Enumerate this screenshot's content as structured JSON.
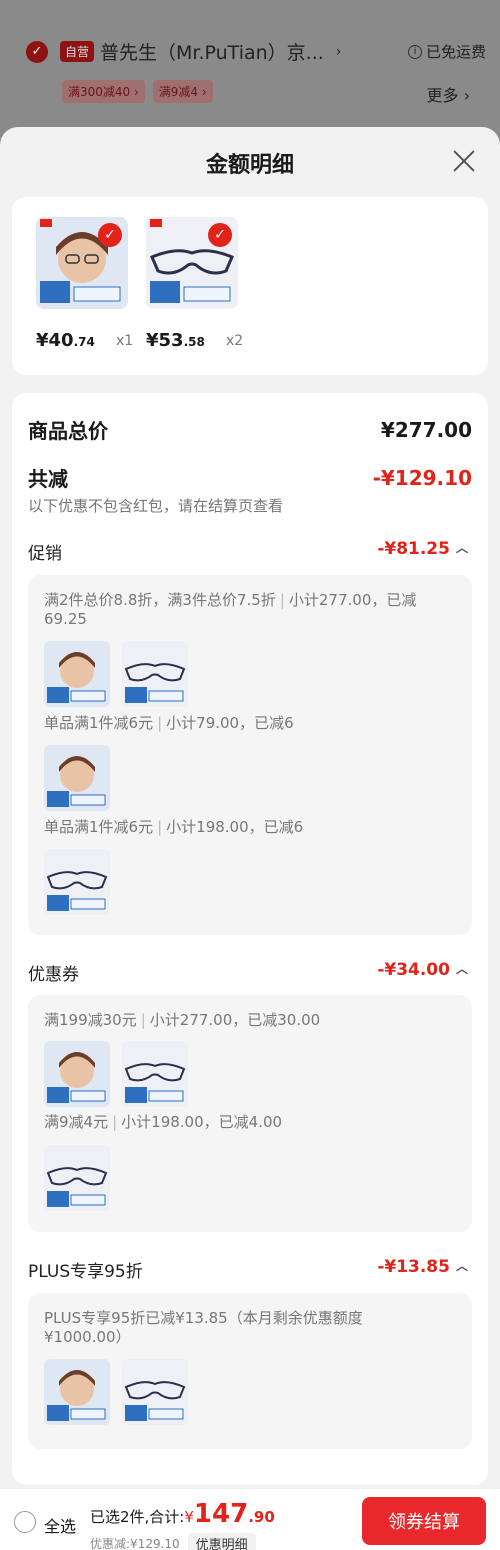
{
  "background": {
    "self_badge": "自营",
    "store_name": "普先生（Mr.PuTian）京...",
    "arrow": "›",
    "shipping": "已免运费",
    "info": "i",
    "tags": [
      "满300减40 ›",
      "满9减4 ›"
    ],
    "more": "更多 ›"
  },
  "sheet": {
    "title": "金额明细"
  },
  "products": [
    {
      "price_main": "¥40",
      "price_dec": ".74",
      "qty": "x1"
    },
    {
      "price_main": "¥53",
      "price_dec": ".58",
      "qty": "x2"
    }
  ],
  "summary": {
    "total_label": "商品总价",
    "total_value": "¥277.00",
    "discount_label": "共减",
    "discount_value": "-¥129.10",
    "discount_note": "以下优惠不包含红包，请在结算页查看"
  },
  "promo": {
    "label": "促销",
    "value": "-¥81.25",
    "lines": [
      {
        "a": "满2件总价8.8折，满3件总价7.5折",
        "b": "小计277.00，已减",
        "c": "69.25"
      },
      {
        "a": "单品满1件减6元",
        "b": "小计79.00，已减6"
      },
      {
        "a": "单品满1件减6元",
        "b": "小计198.00，已减6"
      }
    ]
  },
  "coupon": {
    "label": "优惠券",
    "value": "-¥34.00",
    "lines": [
      {
        "a": "满199减30元",
        "b": "小计277.00，已减30.00"
      },
      {
        "a": "满9减4元",
        "b": "小计198.00，已减4.00"
      }
    ]
  },
  "plus": {
    "label": "PLUS专享95折",
    "value": "-¥13.85",
    "line1": "PLUS专享95折已减¥13.85（本月剩余优惠额度",
    "line2": "¥1000.00）"
  },
  "footer": {
    "select_all": "全选",
    "selected_text": "已选2件,合计:",
    "currency": "¥",
    "total_int": "147",
    "total_dec": ".90",
    "discount": "优惠减:¥129.10",
    "detail_button": "优惠明细",
    "checkout": "领券结算"
  },
  "colors": {
    "accent": "#e2231a",
    "checkout": "#e8282b"
  },
  "icons": {
    "close": "close-icon",
    "check": "check-icon",
    "chevron": "chevron-up-icon"
  }
}
